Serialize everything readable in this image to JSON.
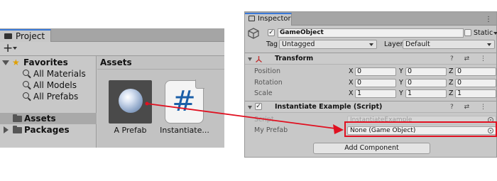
{
  "project": {
    "tab_label": "Project",
    "add_button": "+",
    "tree": {
      "favorites": "Favorites",
      "favorite_items": [
        "All Materials",
        "All Models",
        "All Prefabs"
      ],
      "assets": "Assets",
      "packages": "Packages"
    },
    "assets_header": "Assets",
    "assets": [
      {
        "label": "A Prefab",
        "icon": "prefab-sphere-icon"
      },
      {
        "label": "Instantiate...",
        "icon": "csharp-script-icon",
        "glyph": "#"
      }
    ]
  },
  "inspector": {
    "tab_label": "Inspector",
    "tab_menu": "⋮",
    "gameobject": {
      "active_check": "✓",
      "name": "GameObject",
      "static_label": "Static",
      "tag_label": "Tag",
      "tag_value": "Untagged",
      "layer_label": "Layer",
      "layer_value": "Default"
    },
    "transform": {
      "title": "Transform",
      "icons": "? ⇄ ⋮",
      "rows": [
        {
          "label": "Position",
          "x": "0",
          "y": "0",
          "z": "0"
        },
        {
          "label": "Rotation",
          "x": "0",
          "y": "0",
          "z": "0"
        },
        {
          "label": "Scale",
          "x": "1",
          "y": "1",
          "z": "1"
        }
      ],
      "axes": [
        "X",
        "Y",
        "Z"
      ]
    },
    "script_component": {
      "check": "✓",
      "title": "Instantiate Example (Script)",
      "icons": "? ⇄ ⋮",
      "script_label": "Script",
      "script_value": "InstantiateExample",
      "field_label": "My Prefab",
      "field_value": "None (Game Object)"
    },
    "add_component": "Add Component"
  },
  "colors": {
    "accent": "#3a79d8",
    "highlight_red": "#e01020",
    "script_hash": "#1b5fa8",
    "favorites_star": "#e0a000"
  }
}
